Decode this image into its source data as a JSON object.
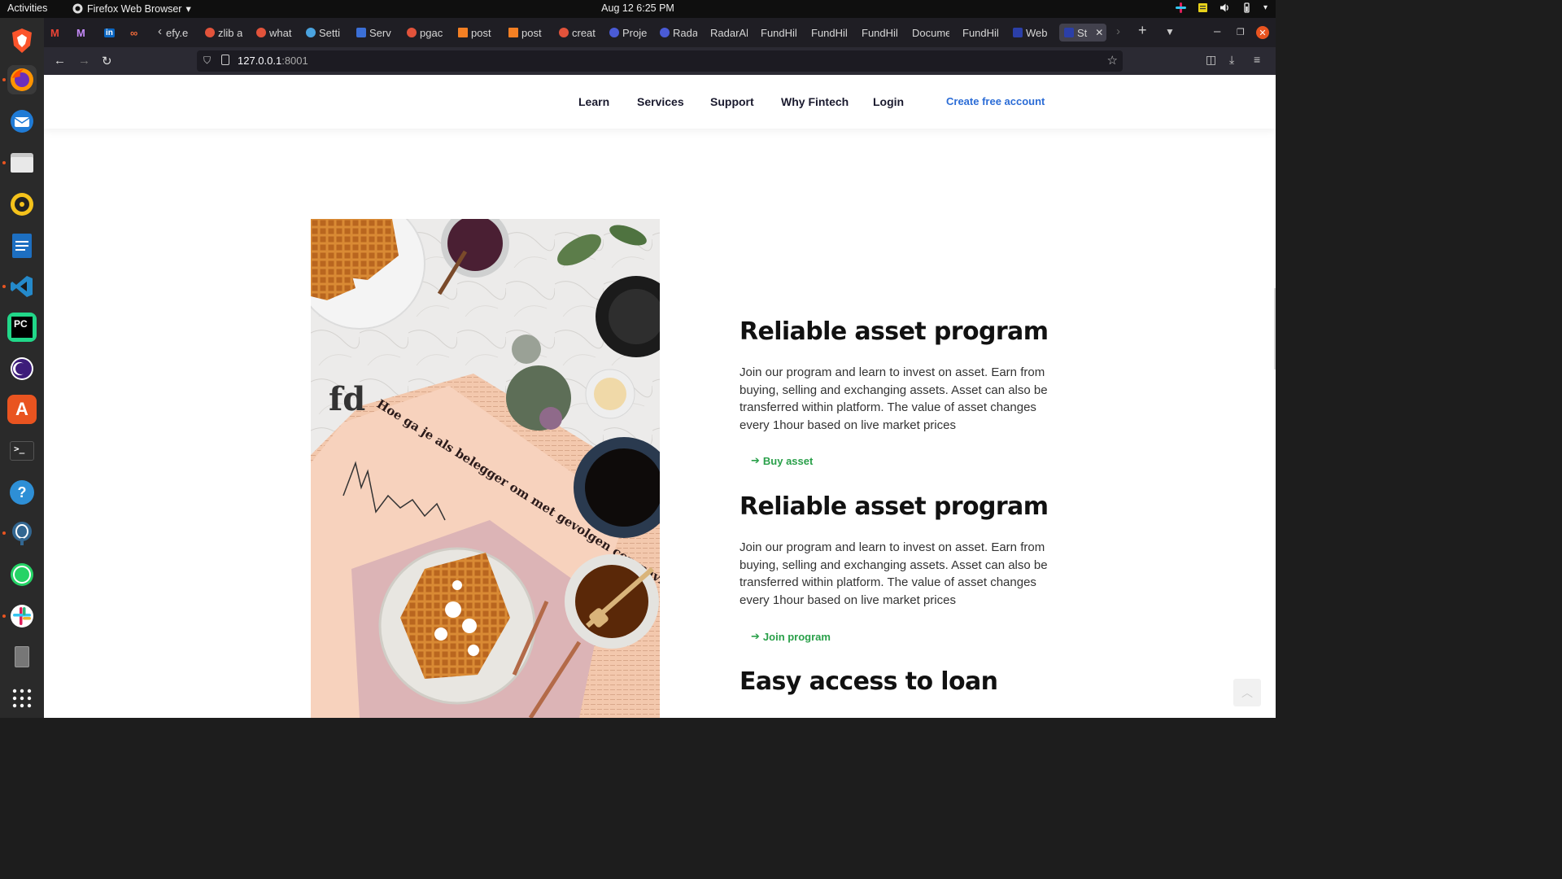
{
  "topbar": {
    "activities": "Activities",
    "app_name": "Firefox Web Browser",
    "clock": "Aug 12  6:25 PM"
  },
  "dock": {
    "apps": [
      "brave",
      "firefox",
      "thunderbird",
      "files",
      "rhythmbox",
      "writer",
      "vscode",
      "pycharm",
      "tor",
      "software",
      "terminal",
      "help",
      "postgres",
      "whatsapp",
      "slack",
      "usb"
    ]
  },
  "tabs": [
    {
      "label": "efy.e",
      "color": "#888"
    },
    {
      "label": "zlib a",
      "color": "#e2533b"
    },
    {
      "label": "what",
      "color": "#e2533b"
    },
    {
      "label": "Setti",
      "color": "#4aa3df"
    },
    {
      "label": "Serv",
      "color": "#3b6fd6"
    },
    {
      "label": "pgac",
      "color": "#e2533b"
    },
    {
      "label": "post",
      "color": "#f48024"
    },
    {
      "label": "post",
      "color": "#f48024"
    },
    {
      "label": "creat",
      "color": "#e2533b"
    },
    {
      "label": "Proje",
      "color": "#4a5bd6"
    },
    {
      "label": "Rada",
      "color": "#4a5bd6"
    },
    {
      "label": "RadarAl",
      "color": ""
    },
    {
      "label": "FundHil",
      "color": ""
    },
    {
      "label": "FundHil",
      "color": ""
    },
    {
      "label": "FundHil",
      "color": ""
    },
    {
      "label": "Docume",
      "color": ""
    },
    {
      "label": "FundHil",
      "color": ""
    },
    {
      "label": "Web",
      "color": "#2b3fa8"
    },
    {
      "label": "St",
      "color": "#2b3fa8"
    }
  ],
  "browser": {
    "url_host": "127.0.0.1",
    "url_port": ":8001"
  },
  "site_nav": {
    "items": [
      "Learn",
      "Services",
      "Support",
      "Why Fintech",
      "Login"
    ],
    "cta": "Create free account"
  },
  "features": [
    {
      "title": "Reliable asset program",
      "text": "Join our program and learn to invest on asset. Earn from buying, selling and exchanging assets. Asset can also be transferred within platform. The value of asset changes every 1hour based on live market prices",
      "link": "Buy asset"
    },
    {
      "title": "Reliable asset program",
      "text": "Join our program and learn to invest on asset. Earn from buying, selling and exchanging assets. Asset can also be transferred within platform. The value of asset changes every 1hour based on live market prices",
      "link": "Join program"
    },
    {
      "title": "Easy access to loan"
    }
  ],
  "hero_image": {
    "newspaper_headline": "Hoe ga je als belegger om met gevolgen coronavirus?",
    "newspaper_masthead": "fd"
  }
}
